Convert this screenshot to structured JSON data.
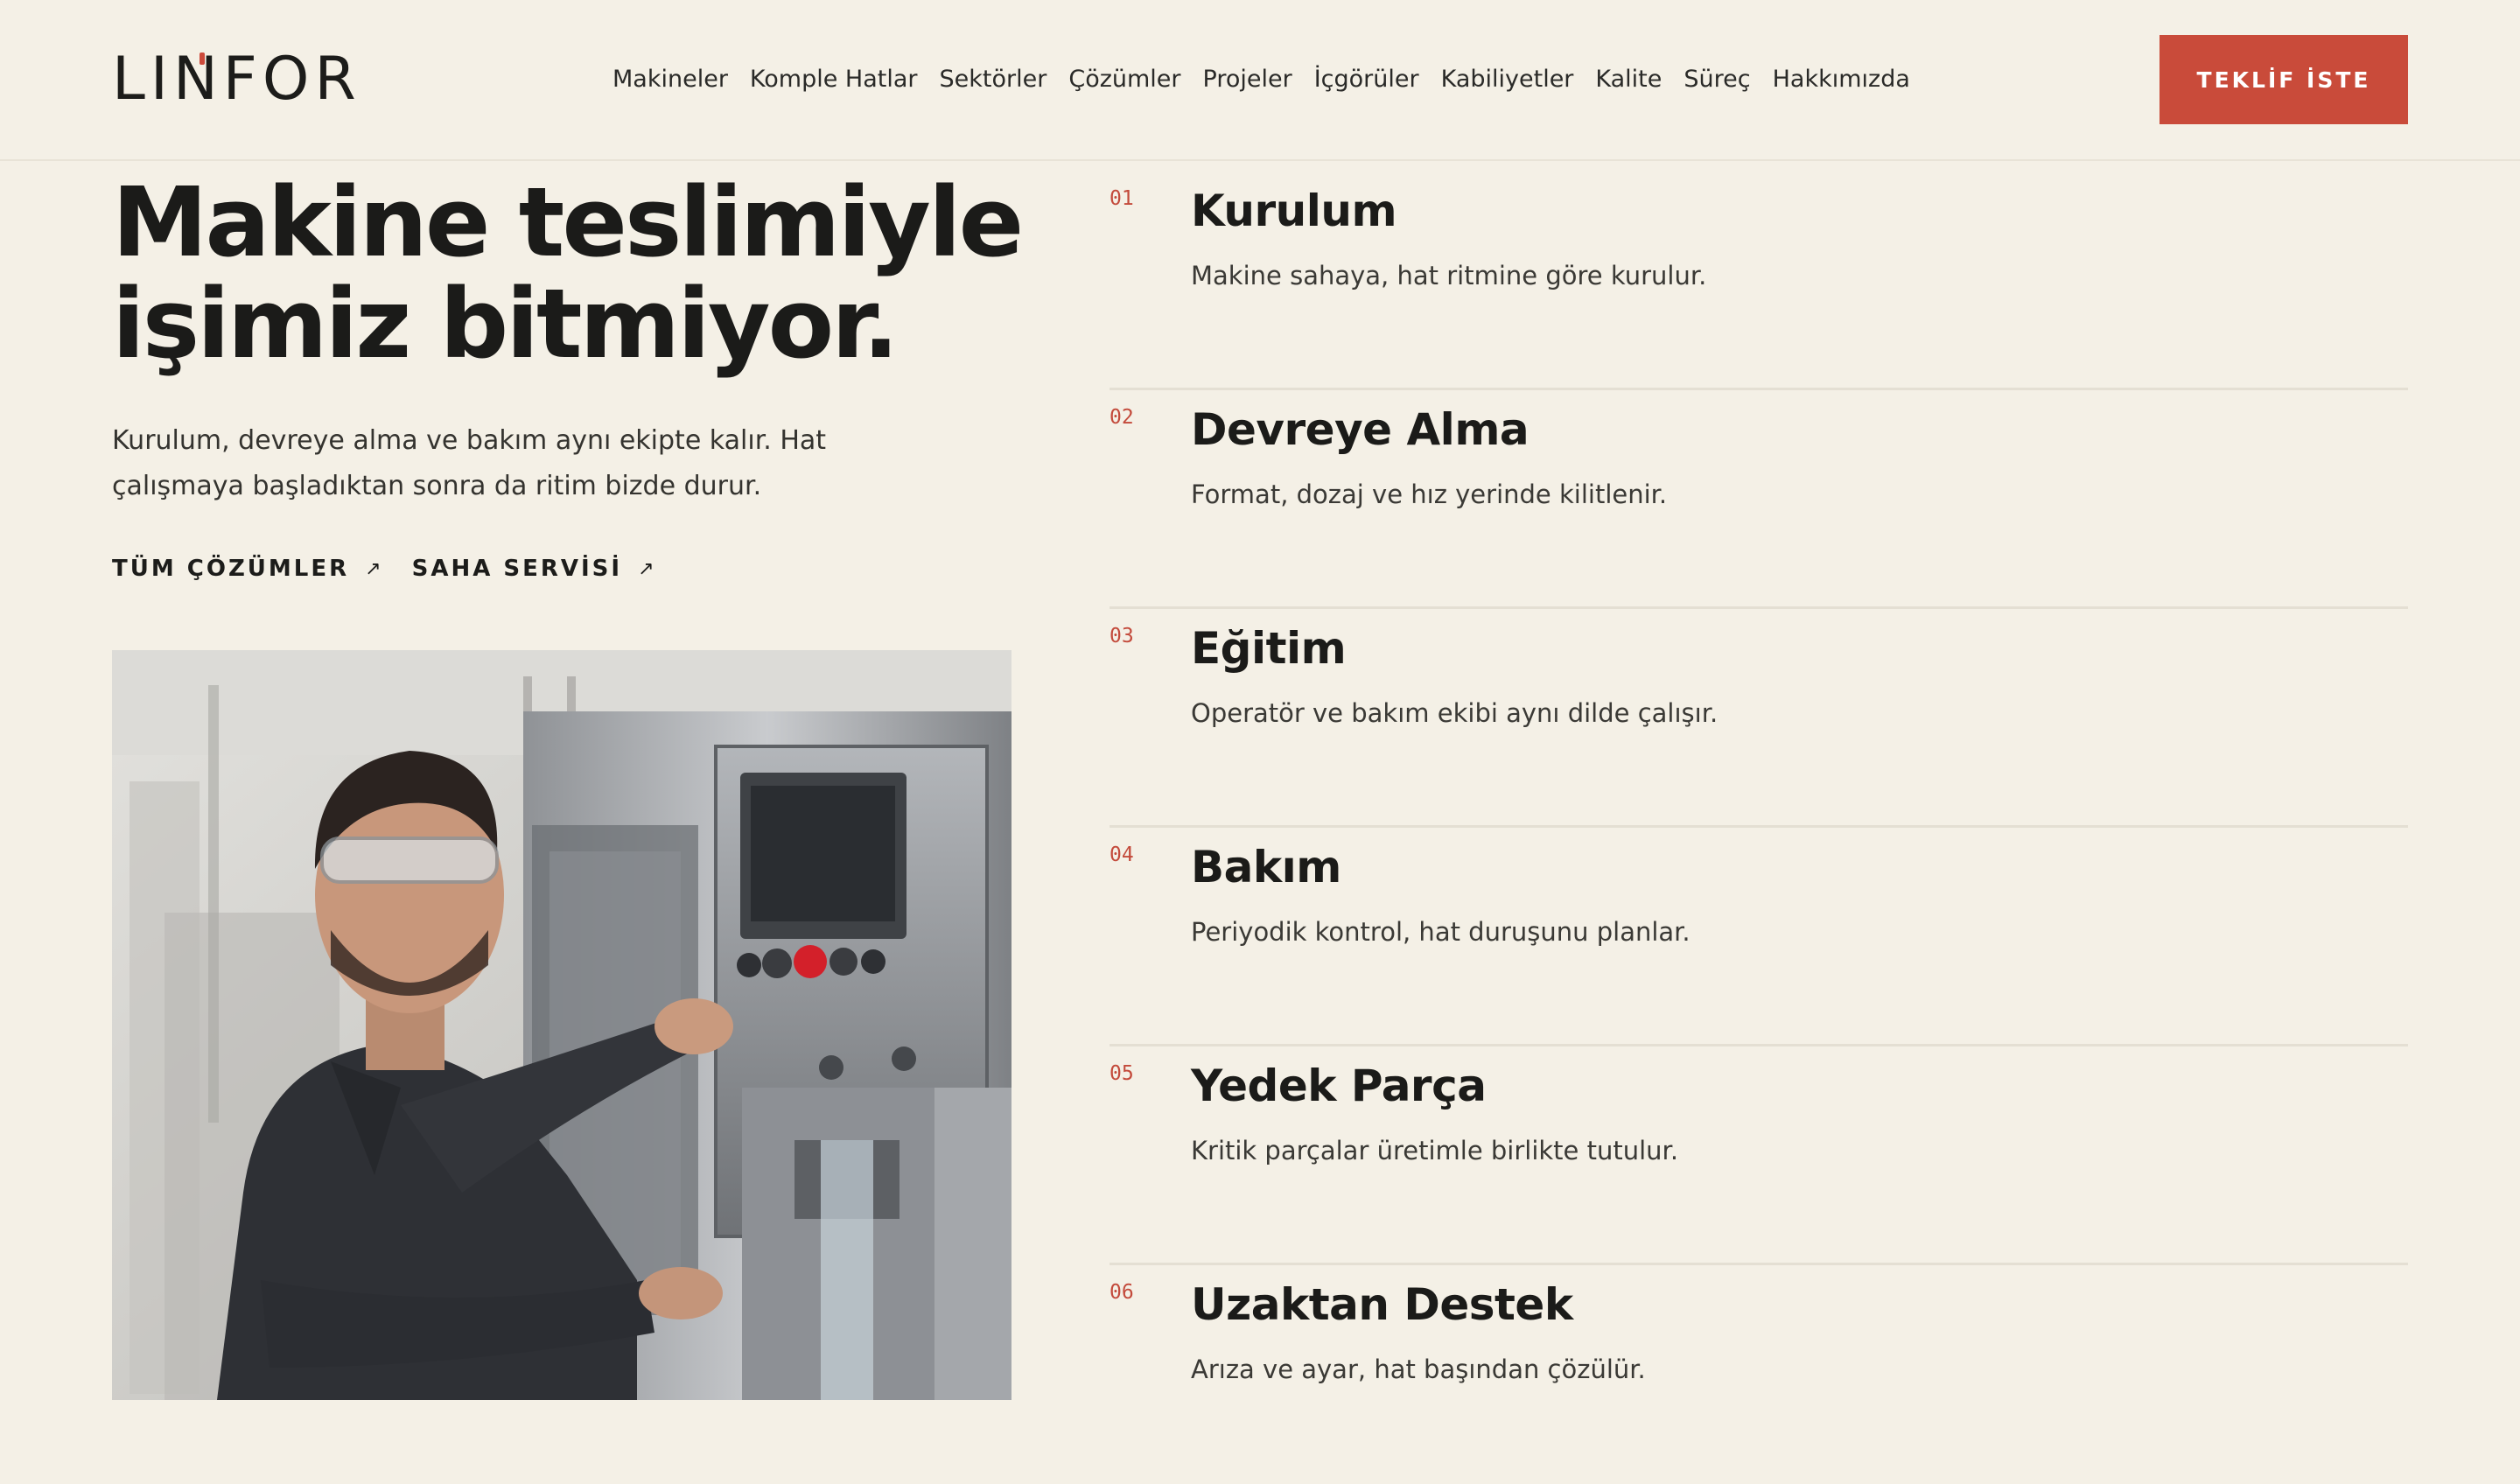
{
  "header": {
    "logo_text": "LINFOR",
    "nav": [
      "Makineler",
      "Komple Hatlar",
      "Sektörler",
      "Çözümler",
      "Projeler",
      "İçgörüler",
      "Kabiliyetler",
      "Kalite",
      "Süreç",
      "Hakkımızda"
    ],
    "cta_label": "TEKLİF İSTE"
  },
  "hero": {
    "title_line1": "Makine teslimiyle",
    "title_line2": "işimiz bitmiyor.",
    "text_line1": "Kurulum, devreye alma ve bakım aynı ekipte kalır. Hat",
    "text_line2": "çalışmaya başladıktan sonra da ritim bizde durur.",
    "link1": "TÜM ÇÖZÜMLER",
    "link2": "SAHA SERVİSİ",
    "arrow": "↗"
  },
  "services": [
    {
      "num": "01",
      "title": "Kurulum",
      "desc": "Makine sahaya, hat ritmine göre kurulur."
    },
    {
      "num": "02",
      "title": "Devreye Alma",
      "desc": "Format, dozaj ve hız yerinde kilitlenir."
    },
    {
      "num": "03",
      "title": "Eğitim",
      "desc": "Operatör ve bakım ekibi aynı dilde çalışır."
    },
    {
      "num": "04",
      "title": "Bakım",
      "desc": "Periyodik kontrol, hat duruşunu planlar."
    },
    {
      "num": "05",
      "title": "Yedek Parça",
      "desc": "Kritik parçalar üretimle birlikte tutulur."
    },
    {
      "num": "06",
      "title": "Uzaktan Destek",
      "desc": "Arıza ve ayar, hat başından çözülür."
    }
  ],
  "colors": {
    "background": "#f4f0e6",
    "accent": "#c94b3a",
    "text": "#1c1c1a"
  }
}
